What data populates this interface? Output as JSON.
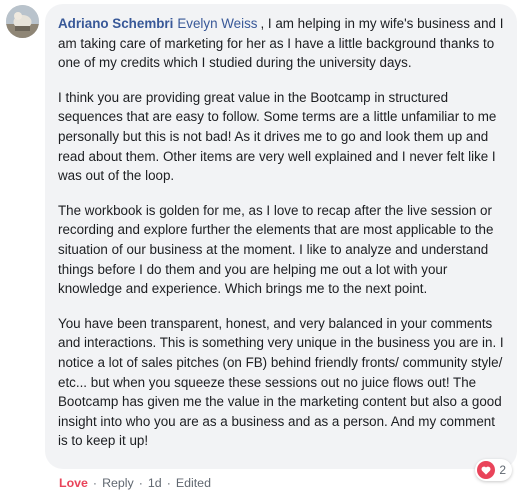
{
  "comment": {
    "author_name": "Adriano Schembri",
    "mention": "Evelyn Weiss",
    "paragraphs": [
      ", I am helping in my wife's business and I am taking care of marketing for her as I have a little background thanks to one of my credits which I studied during the university days.",
      "I think you are providing great value in the Bootcamp in structured sequences that are easy to follow. Some terms are a little unfamiliar to me personally but this is not bad! As it drives me to go and look them up and read about them. Other items are very well explained and I never felt like I was out of the loop.",
      "The workbook is golden for me, as I love to recap after the live session or recording and explore further the elements that are most applicable to the situation of our business at the moment. I like to analyze and understand things before I do them and you are helping me out a lot with your knowledge and experience. Which brings me to the next point.",
      "You have been transparent, honest, and very balanced in your comments and interactions. This is something very unique in the business you are in. I notice a lot of sales pitches (on FB) behind friendly fronts/ community style/ etc... but when you squeeze these sessions out no juice flows out! The Bootcamp has given me the value in the marketing content but also a good insight into who you are as a business and as a person. And my comment is to keep it up!"
    ],
    "reactions": {
      "icon": "heart-icon",
      "count": "2",
      "color": "#e9445a"
    }
  },
  "actions": {
    "love_label": "Love",
    "reply_label": "Reply",
    "time": "1d",
    "edited": "Edited",
    "separator": "·"
  },
  "colors": {
    "bubble_bg": "#f2f3f5",
    "name_link": "#385898",
    "meta_text": "#606770",
    "love_red": "#e9445a"
  }
}
